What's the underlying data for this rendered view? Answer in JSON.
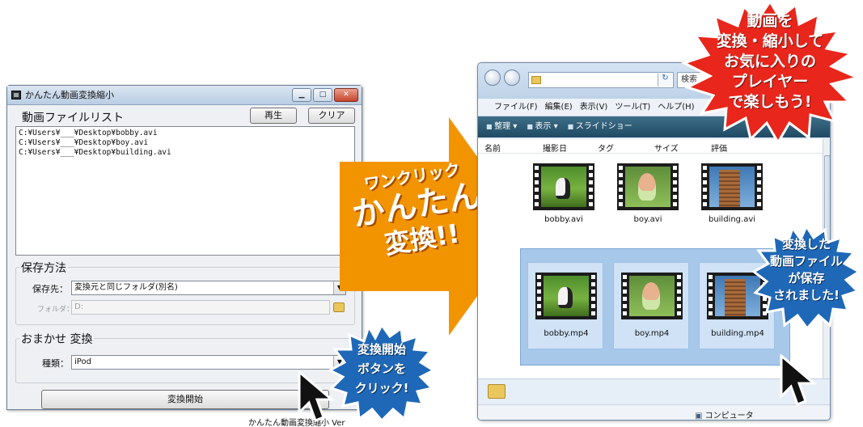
{
  "app": {
    "title": "かんたん動画変換縮小",
    "list_title": "動画ファイルリスト",
    "play_label": "再生",
    "clear_label": "クリア",
    "files": [
      "C:¥Users¥___¥Desktop¥bobby.avi",
      "C:¥Users¥___¥Desktop¥boy.avi",
      "C:¥Users¥___¥Desktop¥building.avi"
    ],
    "save_group_title": "保存方法",
    "save_dest_label": "保存先：",
    "save_dest_value": "変換元と同じフォルダ(別名)",
    "folder_label": "フォルダ：",
    "folder_value": "D:",
    "auto_group_title": "おまかせ 変換",
    "type_label": "種類：",
    "type_value": "iPod",
    "convert_label": "変換開始",
    "status_text": "かんたん動画変換縮小 Ver"
  },
  "arrow": {
    "line1": "ワンクリック",
    "line2": "かんたん",
    "line3": "変換!!"
  },
  "explorer": {
    "search_placeholder": "検索",
    "menu": [
      "ファイル(F)",
      "編集(E)",
      "表示(V)",
      "ツール(T)",
      "ヘルプ(H)"
    ],
    "toolbar": [
      "整理 ▾",
      "表示 ▾",
      "スライドショー"
    ],
    "columns": [
      "名前",
      "撮影日",
      "タグ",
      "サイズ",
      "評価"
    ],
    "originals": [
      "bobby.avi",
      "boy.avi",
      "building.avi"
    ],
    "converted": [
      "bobby.mp4",
      "boy.mp4",
      "building.mp4"
    ],
    "status": "コンピュータ"
  },
  "badges": {
    "top_right": [
      "動画を",
      "変換・縮小して",
      "お気に入りの",
      "プレイヤー",
      "で楽しもう!"
    ],
    "saved": [
      "変換した",
      "動画ファイル",
      "が保存",
      "されました!"
    ],
    "start": [
      "変換開始",
      "ボタンを",
      "クリック!"
    ]
  },
  "colors": {
    "arrow_orange": "#f29400",
    "badge_red": "#e8261c",
    "badge_blue": "#1f68b8",
    "explorer_toolbar": "#2a5570",
    "selection_blue": "#a8c8ea"
  }
}
